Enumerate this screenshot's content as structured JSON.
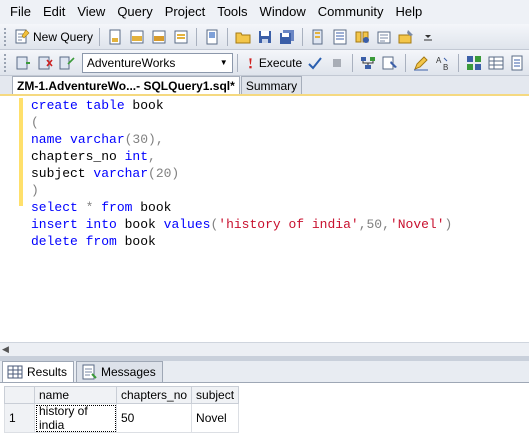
{
  "menu": [
    "File",
    "Edit",
    "View",
    "Query",
    "Project",
    "Tools",
    "Window",
    "Community",
    "Help"
  ],
  "toolbar1": {
    "new_query_label": "New Query"
  },
  "toolbar2": {
    "database": "AdventureWorks",
    "execute_label": "Execute"
  },
  "tabs": {
    "query_tab": "ZM-1.AdventureWo...- SQLQuery1.sql*",
    "summary_tab": "Summary"
  },
  "editor": {
    "lines": [
      [
        {
          "t": "create table ",
          "c": "kw"
        },
        {
          "t": "book",
          "c": "plain"
        }
      ],
      [
        {
          "t": "(",
          "c": "op"
        }
      ],
      [
        {
          "t": "name ",
          "c": "kw"
        },
        {
          "t": "varchar",
          "c": "kw"
        },
        {
          "t": "(30),",
          "c": "op"
        }
      ],
      [
        {
          "t": "chapters_no ",
          "c": "plain"
        },
        {
          "t": "int",
          "c": "kw"
        },
        {
          "t": ",",
          "c": "op"
        }
      ],
      [
        {
          "t": "subject ",
          "c": "plain"
        },
        {
          "t": "varchar",
          "c": "kw"
        },
        {
          "t": "(20)",
          "c": "op"
        }
      ],
      [
        {
          "t": ")",
          "c": "op"
        }
      ],
      [
        {
          "t": "select ",
          "c": "kw"
        },
        {
          "t": "* ",
          "c": "op"
        },
        {
          "t": "from ",
          "c": "kw"
        },
        {
          "t": "book",
          "c": "plain"
        }
      ],
      [
        {
          "t": "insert into ",
          "c": "kw"
        },
        {
          "t": "book ",
          "c": "plain"
        },
        {
          "t": "values",
          "c": "kw"
        },
        {
          "t": "(",
          "c": "op"
        },
        {
          "t": "'history of india'",
          "c": "str"
        },
        {
          "t": ",50,",
          "c": "op"
        },
        {
          "t": "'Novel'",
          "c": "str"
        },
        {
          "t": ")",
          "c": "op"
        }
      ],
      [
        {
          "t": "delete from ",
          "c": "kw"
        },
        {
          "t": "book",
          "c": "plain"
        }
      ]
    ]
  },
  "results": {
    "results_tab": "Results",
    "messages_tab": "Messages",
    "columns": [
      "name",
      "chapters_no",
      "subject"
    ],
    "rows": [
      {
        "num": "1",
        "cells": [
          "history of india",
          "50",
          "Novel"
        ]
      }
    ]
  }
}
